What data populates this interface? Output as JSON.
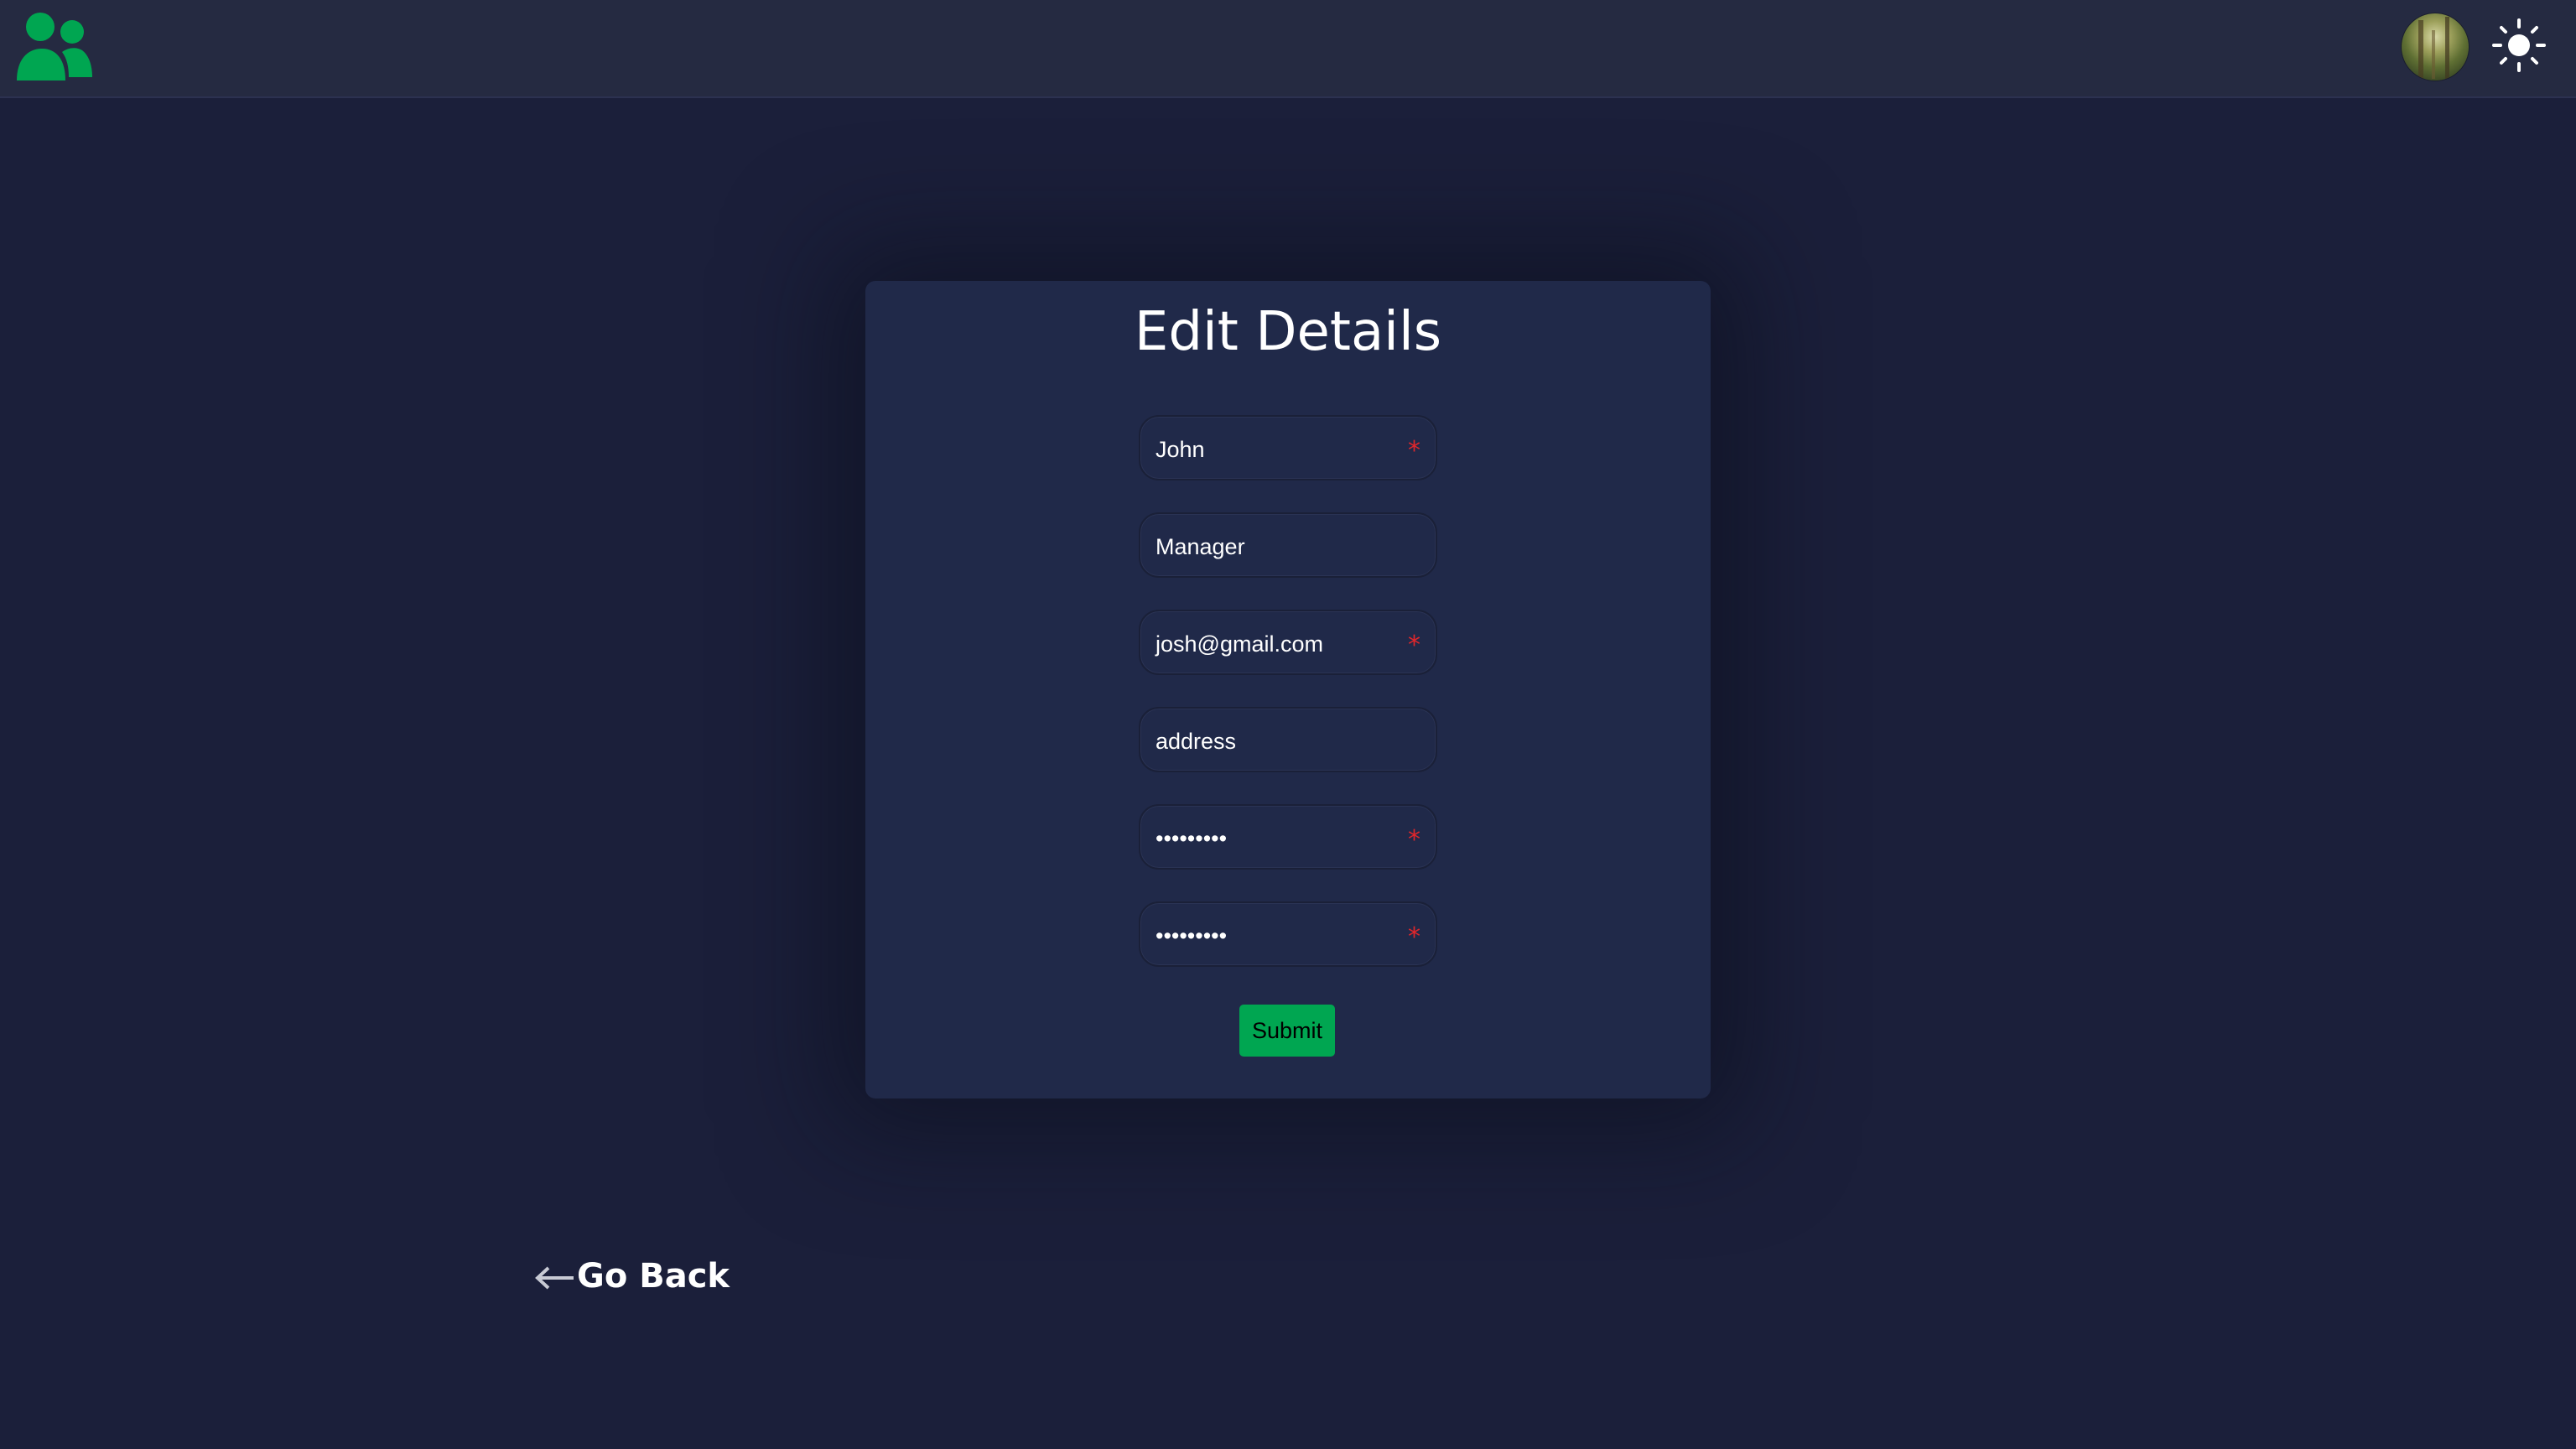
{
  "header": {
    "logo_icon": "users-group-icon",
    "avatar_icon": "user-avatar",
    "theme_toggle_icon": "sun-icon",
    "brand_color": "#00a651"
  },
  "form": {
    "title": "Edit Details",
    "fields": [
      {
        "name": "first-name",
        "value": "John",
        "required": true
      },
      {
        "name": "role",
        "value": "Manager",
        "required": false
      },
      {
        "name": "email",
        "value": "josh@gmail.com",
        "required": true
      },
      {
        "name": "address",
        "value": "address",
        "required": false
      },
      {
        "name": "password",
        "value": "•••••••••",
        "required": true
      },
      {
        "name": "confirm-password",
        "value": "•••••••••",
        "required": true
      }
    ],
    "required_marker": "*",
    "submit_label": "Submit"
  },
  "nav": {
    "go_back_label": "Go Back",
    "go_back_icon": "arrow-left-icon"
  }
}
